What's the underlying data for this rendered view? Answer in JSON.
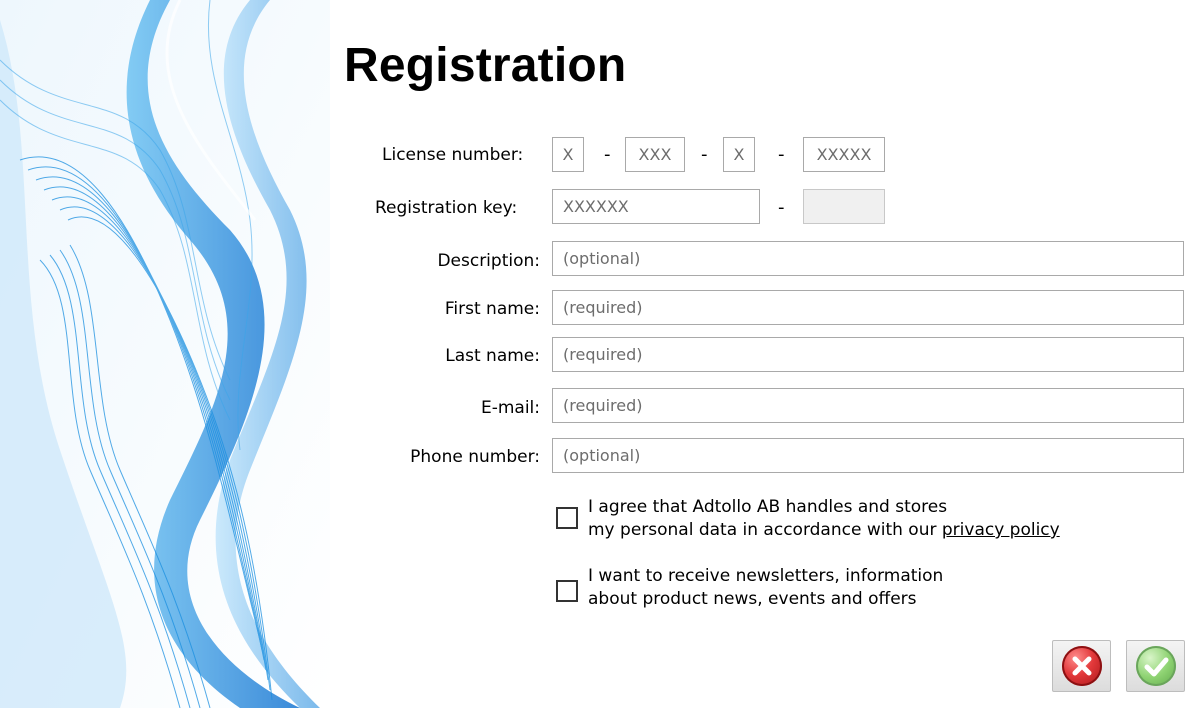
{
  "title": "Registration",
  "license": {
    "label": "License number:",
    "parts": [
      "X",
      "XXX",
      "X",
      "XXXXX"
    ],
    "separator": "-"
  },
  "registration_key": {
    "label": "Registration key:",
    "value": "XXXXXX",
    "separator": "-",
    "suffix_value": ""
  },
  "fields": {
    "description": {
      "label": "Description:",
      "placeholder": "(optional)"
    },
    "first_name": {
      "label": "First name:",
      "placeholder": "(required)"
    },
    "last_name": {
      "label": "Last name:",
      "placeholder": "(required)"
    },
    "email": {
      "label": "E-mail:",
      "placeholder": "(required)"
    },
    "phone": {
      "label": "Phone number:",
      "placeholder": "(optional)"
    }
  },
  "checkboxes": {
    "privacy": {
      "line1": "I agree that Adtollo AB handles and stores",
      "line2_prefix": "my personal data in accordance with our ",
      "link": "privacy policy",
      "checked": false
    },
    "newsletter": {
      "line1": "I want to receive newsletters, information",
      "line2": "about product news, events and offers",
      "checked": false
    }
  },
  "buttons": {
    "cancel_icon": "cancel-x-icon",
    "ok_icon": "ok-checkmark-icon"
  },
  "colors": {
    "cancel": "#e2383a",
    "ok": "#8fd373",
    "accent_wave": "#1e90ff"
  }
}
